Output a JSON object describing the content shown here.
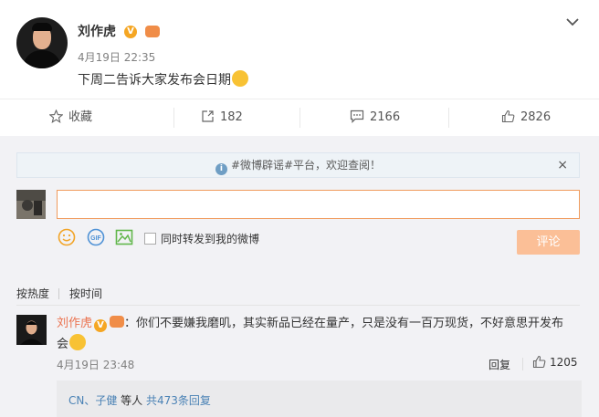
{
  "post": {
    "author": "刘作虎",
    "vbadge": "V",
    "timestamp": "4月19日 22:35",
    "text": "下周二告诉大家发布会日期"
  },
  "actions": {
    "favorite_label": "收藏",
    "repost_count": "182",
    "comment_count": "2166",
    "like_count": "2826"
  },
  "notice": {
    "text": "#微博辟谣#平台，欢迎查阅！",
    "close": "×"
  },
  "composer": {
    "repost_label": "同时转发到我的微博",
    "submit_label": "评论"
  },
  "sort": {
    "hot": "按热度",
    "time": "按时间"
  },
  "comment": {
    "author": "刘作虎",
    "vbadge": "V",
    "text": "：你们不要嫌我磨叽，其实新品已经在量产，只是没有一百万现货，不好意思开发布",
    "text_cont": "会",
    "timestamp": "4月19日 23:48",
    "reply_label": "回复",
    "like_count": "1205",
    "replies": {
      "names": "CN、子健",
      "suffix": " 等人 ",
      "count_link": "共473条回复"
    }
  },
  "colors": {
    "accent": "#eb7350",
    "link_blue": "#4a82b5",
    "submit_disabled": "#fbbf97",
    "input_focus": "#f09b5d"
  }
}
